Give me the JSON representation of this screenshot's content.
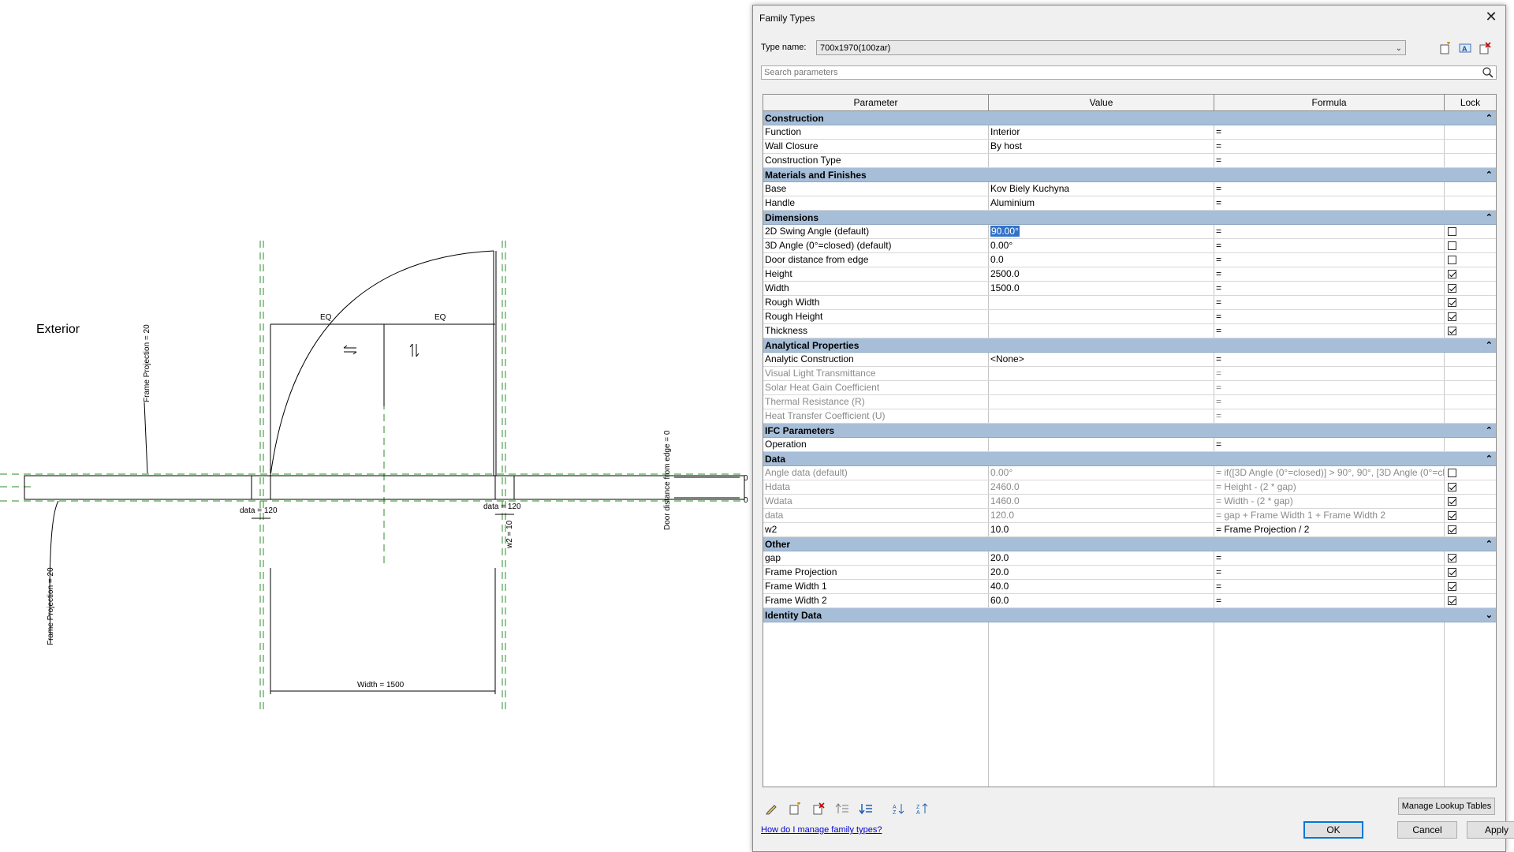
{
  "drawing": {
    "exterior_label": "Exterior",
    "frame_projection_top": "Frame Projection = 20",
    "frame_projection_bottom": "Frame Projection = 20",
    "eq_left": "EQ",
    "eq_right": "EQ",
    "data_left": "data = 120",
    "data_right": "data = 120",
    "w2": "w2 = 10",
    "door_distance": "Door distance from edge = 0",
    "width": "Width = 1500",
    "zero_top": "0",
    "zero_bottom": "0"
  },
  "dialog": {
    "title": "Family Types",
    "type_name_label": "Type name:",
    "type_name_value": "700x1970(100zar)",
    "search_placeholder": "Search parameters",
    "columns": [
      "Parameter",
      "Value",
      "Formula",
      "Lock"
    ],
    "groups": [
      {
        "name": "Construction",
        "collapse": "⌃",
        "rows": [
          {
            "param": "Function",
            "value": "Interior",
            "formula": "=",
            "lock": null,
            "readonly": false
          },
          {
            "param": "Wall Closure",
            "value": "By host",
            "formula": "=",
            "lock": null,
            "readonly": false
          },
          {
            "param": "Construction Type",
            "value": "",
            "formula": "=",
            "lock": null,
            "readonly": false
          }
        ]
      },
      {
        "name": "Materials and Finishes",
        "collapse": "⌃",
        "rows": [
          {
            "param": "Base",
            "value": "Kov Biely Kuchyna",
            "formula": "=",
            "lock": null,
            "readonly": false
          },
          {
            "param": "Handle",
            "value": "Aluminium",
            "formula": "=",
            "lock": null,
            "readonly": false
          }
        ]
      },
      {
        "name": "Dimensions",
        "collapse": "⌃",
        "rows": [
          {
            "param": "2D Swing Angle (default)",
            "value": "90.00°",
            "formula": "=",
            "lock": false,
            "readonly": false,
            "selected": true
          },
          {
            "param": "3D Angle (0°=closed) (default)",
            "value": "0.00°",
            "formula": "=",
            "lock": false,
            "readonly": false
          },
          {
            "param": "Door distance from edge",
            "value": "0.0",
            "formula": "=",
            "lock": false,
            "readonly": false
          },
          {
            "param": "Height",
            "value": "2500.0",
            "formula": "=",
            "lock": true,
            "readonly": false
          },
          {
            "param": "Width",
            "value": "1500.0",
            "formula": "=",
            "lock": true,
            "readonly": false
          },
          {
            "param": "Rough Width",
            "value": "",
            "formula": "=",
            "lock": true,
            "readonly": false
          },
          {
            "param": "Rough Height",
            "value": "",
            "formula": "=",
            "lock": true,
            "readonly": false
          },
          {
            "param": "Thickness",
            "value": "",
            "formula": "=",
            "lock": true,
            "readonly": false
          }
        ]
      },
      {
        "name": "Analytical Properties",
        "collapse": "⌃",
        "rows": [
          {
            "param": "Analytic Construction",
            "value": "<None>",
            "formula": "=",
            "lock": null,
            "readonly": false
          },
          {
            "param": "Visual Light Transmittance",
            "value": "",
            "formula": "=",
            "lock": null,
            "readonly": true
          },
          {
            "param": "Solar Heat Gain Coefficient",
            "value": "",
            "formula": "=",
            "lock": null,
            "readonly": true
          },
          {
            "param": "Thermal Resistance (R)",
            "value": "",
            "formula": "=",
            "lock": null,
            "readonly": true
          },
          {
            "param": "Heat Transfer Coefficient (U)",
            "value": "",
            "formula": "=",
            "lock": null,
            "readonly": true
          }
        ]
      },
      {
        "name": "IFC Parameters",
        "collapse": "⌃",
        "rows": [
          {
            "param": "Operation",
            "value": "",
            "formula": "=",
            "lock": null,
            "readonly": false
          }
        ]
      },
      {
        "name": "Data",
        "collapse": "⌃",
        "rows": [
          {
            "param": "Angle data (default)",
            "value": "0.00°",
            "formula": "= if([3D Angle (0°=closed)] > 90°, 90°, [3D Angle (0°=cl",
            "lock": false,
            "readonly": true
          },
          {
            "param": "Hdata",
            "value": "2460.0",
            "formula": "= Height - (2 * gap)",
            "lock": true,
            "readonly": true
          },
          {
            "param": "Wdata",
            "value": "1460.0",
            "formula": "= Width - (2 * gap)",
            "lock": true,
            "readonly": true
          },
          {
            "param": "data",
            "value": "120.0",
            "formula": "= gap + Frame Width 1 + Frame Width 2",
            "lock": true,
            "readonly": true
          },
          {
            "param": "w2",
            "value": "10.0",
            "formula": "= Frame Projection / 2",
            "lock": true,
            "readonly": false
          }
        ]
      },
      {
        "name": "Other",
        "collapse": "⌃",
        "rows": [
          {
            "param": "gap",
            "value": "20.0",
            "formula": "=",
            "lock": true,
            "readonly": false
          },
          {
            "param": "Frame Projection",
            "value": "20.0",
            "formula": "=",
            "lock": true,
            "readonly": false
          },
          {
            "param": "Frame Width 1",
            "value": "40.0",
            "formula": "=",
            "lock": true,
            "readonly": false
          },
          {
            "param": "Frame Width 2",
            "value": "60.0",
            "formula": "=",
            "lock": true,
            "readonly": false
          }
        ]
      },
      {
        "name": "Identity Data",
        "collapse": "⌄",
        "rows": []
      }
    ],
    "manage_lookup_label": "Manage Lookup Tables",
    "help_link": "How do I manage family types?",
    "ok_label": "OK",
    "cancel_label": "Cancel",
    "apply_label": "Apply",
    "close_glyph": "✕"
  }
}
